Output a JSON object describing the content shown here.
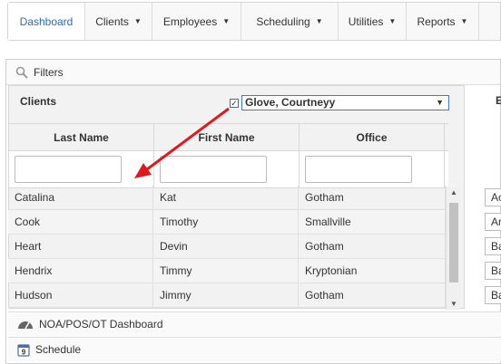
{
  "nav": {
    "items": [
      {
        "label": "Dashboard",
        "active": true,
        "caret": false
      },
      {
        "label": "Clients",
        "caret": true
      },
      {
        "label": "Employees",
        "caret": true
      },
      {
        "label": "Scheduling",
        "caret": true
      },
      {
        "label": "Utilities",
        "caret": true
      },
      {
        "label": "Reports",
        "caret": true
      }
    ],
    "caret_glyph": "▼"
  },
  "filters": {
    "label": "Filters",
    "clients_title": "Clients",
    "checkbox_checked": true,
    "selected_coordinator": "Glove, Courtneyy",
    "columns": [
      "Last Name",
      "First Name",
      "Office"
    ],
    "rows": [
      [
        "Catalina",
        "Kat",
        "Gotham"
      ],
      [
        "Cook",
        "Timothy",
        "Smallville"
      ],
      [
        "Heart",
        "Devin",
        "Gotham"
      ],
      [
        "Hendrix",
        "Timmy",
        "Kryptonian"
      ],
      [
        "Hudson",
        "Jimmy",
        "Gotham"
      ]
    ],
    "right_panel_title": "E",
    "right_panel_cells": [
      "Ac",
      "Ar",
      "Ba",
      "Ba",
      "Ba"
    ]
  },
  "footer": {
    "noa": "NOA/POS/OT Dashboard",
    "schedule": "Schedule",
    "schedule_icon_number": "9"
  },
  "colors": {
    "active_nav": "#2b6cb0",
    "select_border": "#3a7bd5",
    "annotation_arrow": "#e0191f"
  }
}
